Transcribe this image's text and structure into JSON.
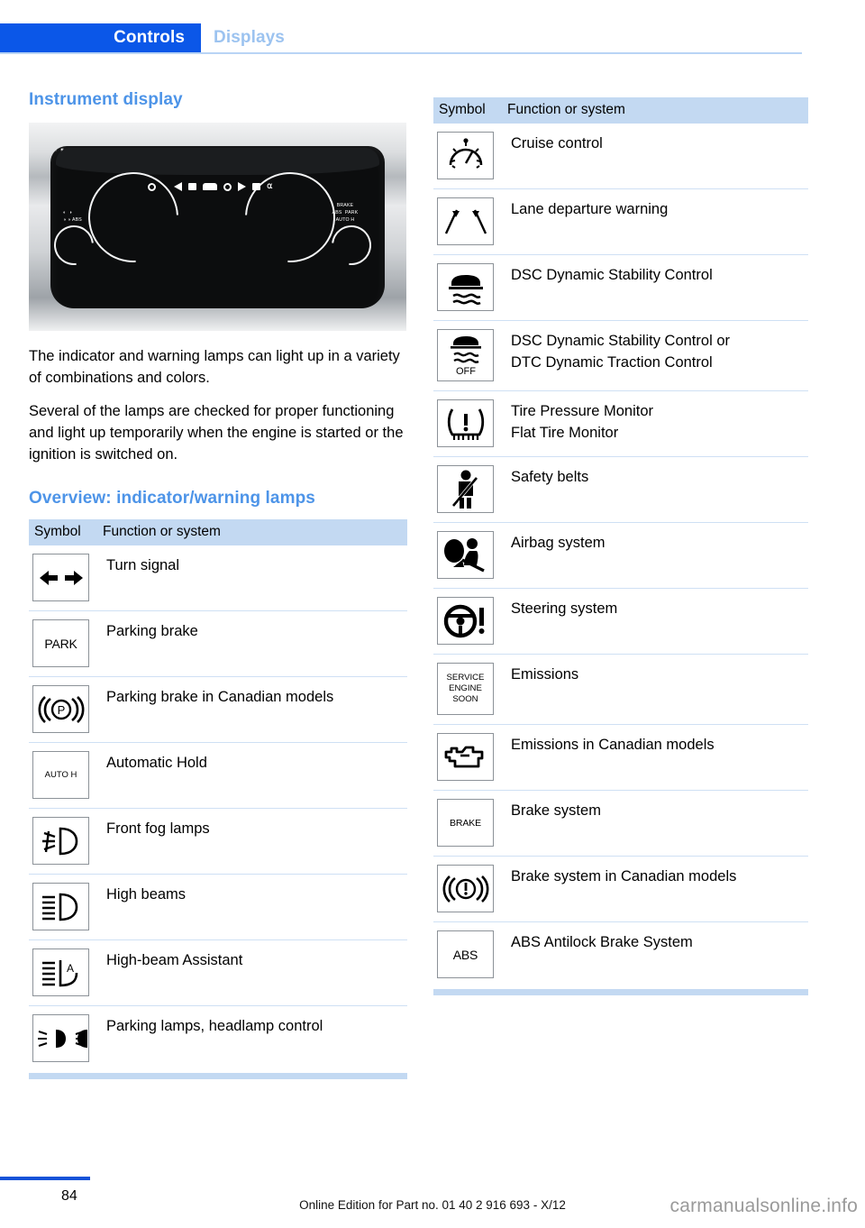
{
  "header": {
    "active_tab": "Controls",
    "inactive_tab": "Displays",
    "active_color": "#0b57e8",
    "inactive_color": "#9cc3f0"
  },
  "left_column": {
    "section_title": "Instrument display",
    "photo_alt": "instrument-cluster-photo",
    "cluster_labels": {
      "left_mini": "ABS",
      "right_mini_1": "BRAKE",
      "right_mini_2": "ABS",
      "right_mini_3": "PARK",
      "right_mini_4": "AUTO H"
    },
    "paragraphs": [
      "The indicator and warning lamps can light up in a variety of combinations and colors.",
      "Several of the lamps are checked for proper functioning and light up temporarily when the engine is started or the ignition is switched on."
    ],
    "overview_title": "Overview: indicator/warning lamps",
    "table": {
      "headers": {
        "symbol": "Symbol",
        "function": "Function or system"
      },
      "rows": [
        {
          "symbol_kind": "turn-signal",
          "symbol_text": "",
          "label": "Turn signal"
        },
        {
          "symbol_kind": "text",
          "symbol_text": "PARK",
          "label": "Parking brake"
        },
        {
          "symbol_kind": "park-canada",
          "symbol_text": "((P))",
          "label": "Parking brake in Canadian models"
        },
        {
          "symbol_kind": "text-small",
          "symbol_text": "AUTO H",
          "label": "Automatic Hold"
        },
        {
          "symbol_kind": "front-fog",
          "symbol_text": "",
          "label": "Front fog lamps"
        },
        {
          "symbol_kind": "high-beam",
          "symbol_text": "",
          "label": "High beams"
        },
        {
          "symbol_kind": "high-beam-assist",
          "symbol_text": "",
          "label": "High-beam Assistant"
        },
        {
          "symbol_kind": "parking-lamps",
          "symbol_text": "",
          "label": "Parking lamps, headlamp control"
        }
      ]
    }
  },
  "right_column": {
    "table": {
      "headers": {
        "symbol": "Symbol",
        "function": "Function or system"
      },
      "rows": [
        {
          "symbol_kind": "cruise-control",
          "symbol_text": "",
          "label": "Cruise control",
          "label2": ""
        },
        {
          "symbol_kind": "lane-departure",
          "symbol_text": "",
          "label": "Lane departure warning",
          "label2": ""
        },
        {
          "symbol_kind": "dsc",
          "symbol_text": "",
          "label": "DSC Dynamic Stability Control",
          "label2": ""
        },
        {
          "symbol_kind": "dsc-off",
          "symbol_text": "OFF",
          "label": "DSC Dynamic Stability Control or",
          "label2": "DTC Dynamic Traction Control"
        },
        {
          "symbol_kind": "tire-pressure",
          "symbol_text": "",
          "label": "Tire Pressure Monitor",
          "label2": "Flat Tire Monitor"
        },
        {
          "symbol_kind": "safety-belt",
          "symbol_text": "",
          "label": "Safety belts",
          "label2": ""
        },
        {
          "symbol_kind": "airbag",
          "symbol_text": "",
          "label": "Airbag system",
          "label2": ""
        },
        {
          "symbol_kind": "steering",
          "symbol_text": "",
          "label": "Steering system",
          "label2": ""
        },
        {
          "symbol_kind": "text-stack",
          "symbol_text": "SERVICE\nENGINE\nSOON",
          "label": "Emissions",
          "label2": ""
        },
        {
          "symbol_kind": "check-engine",
          "symbol_text": "",
          "label": "Emissions in Canadian models",
          "label2": ""
        },
        {
          "symbol_kind": "text-small",
          "symbol_text": "BRAKE",
          "label": "Brake system",
          "label2": ""
        },
        {
          "symbol_kind": "brake-canada",
          "symbol_text": "((!))",
          "label": "Brake system in Canadian models",
          "label2": ""
        },
        {
          "symbol_kind": "text",
          "symbol_text": "ABS",
          "label": "ABS Antilock Brake System",
          "label2": ""
        }
      ]
    }
  },
  "footer": {
    "page_number": "84",
    "edition_text": "Online Edition for Part no. 01 40 2 916 693 - X/12",
    "watermark": "carmanualsonline.info"
  }
}
